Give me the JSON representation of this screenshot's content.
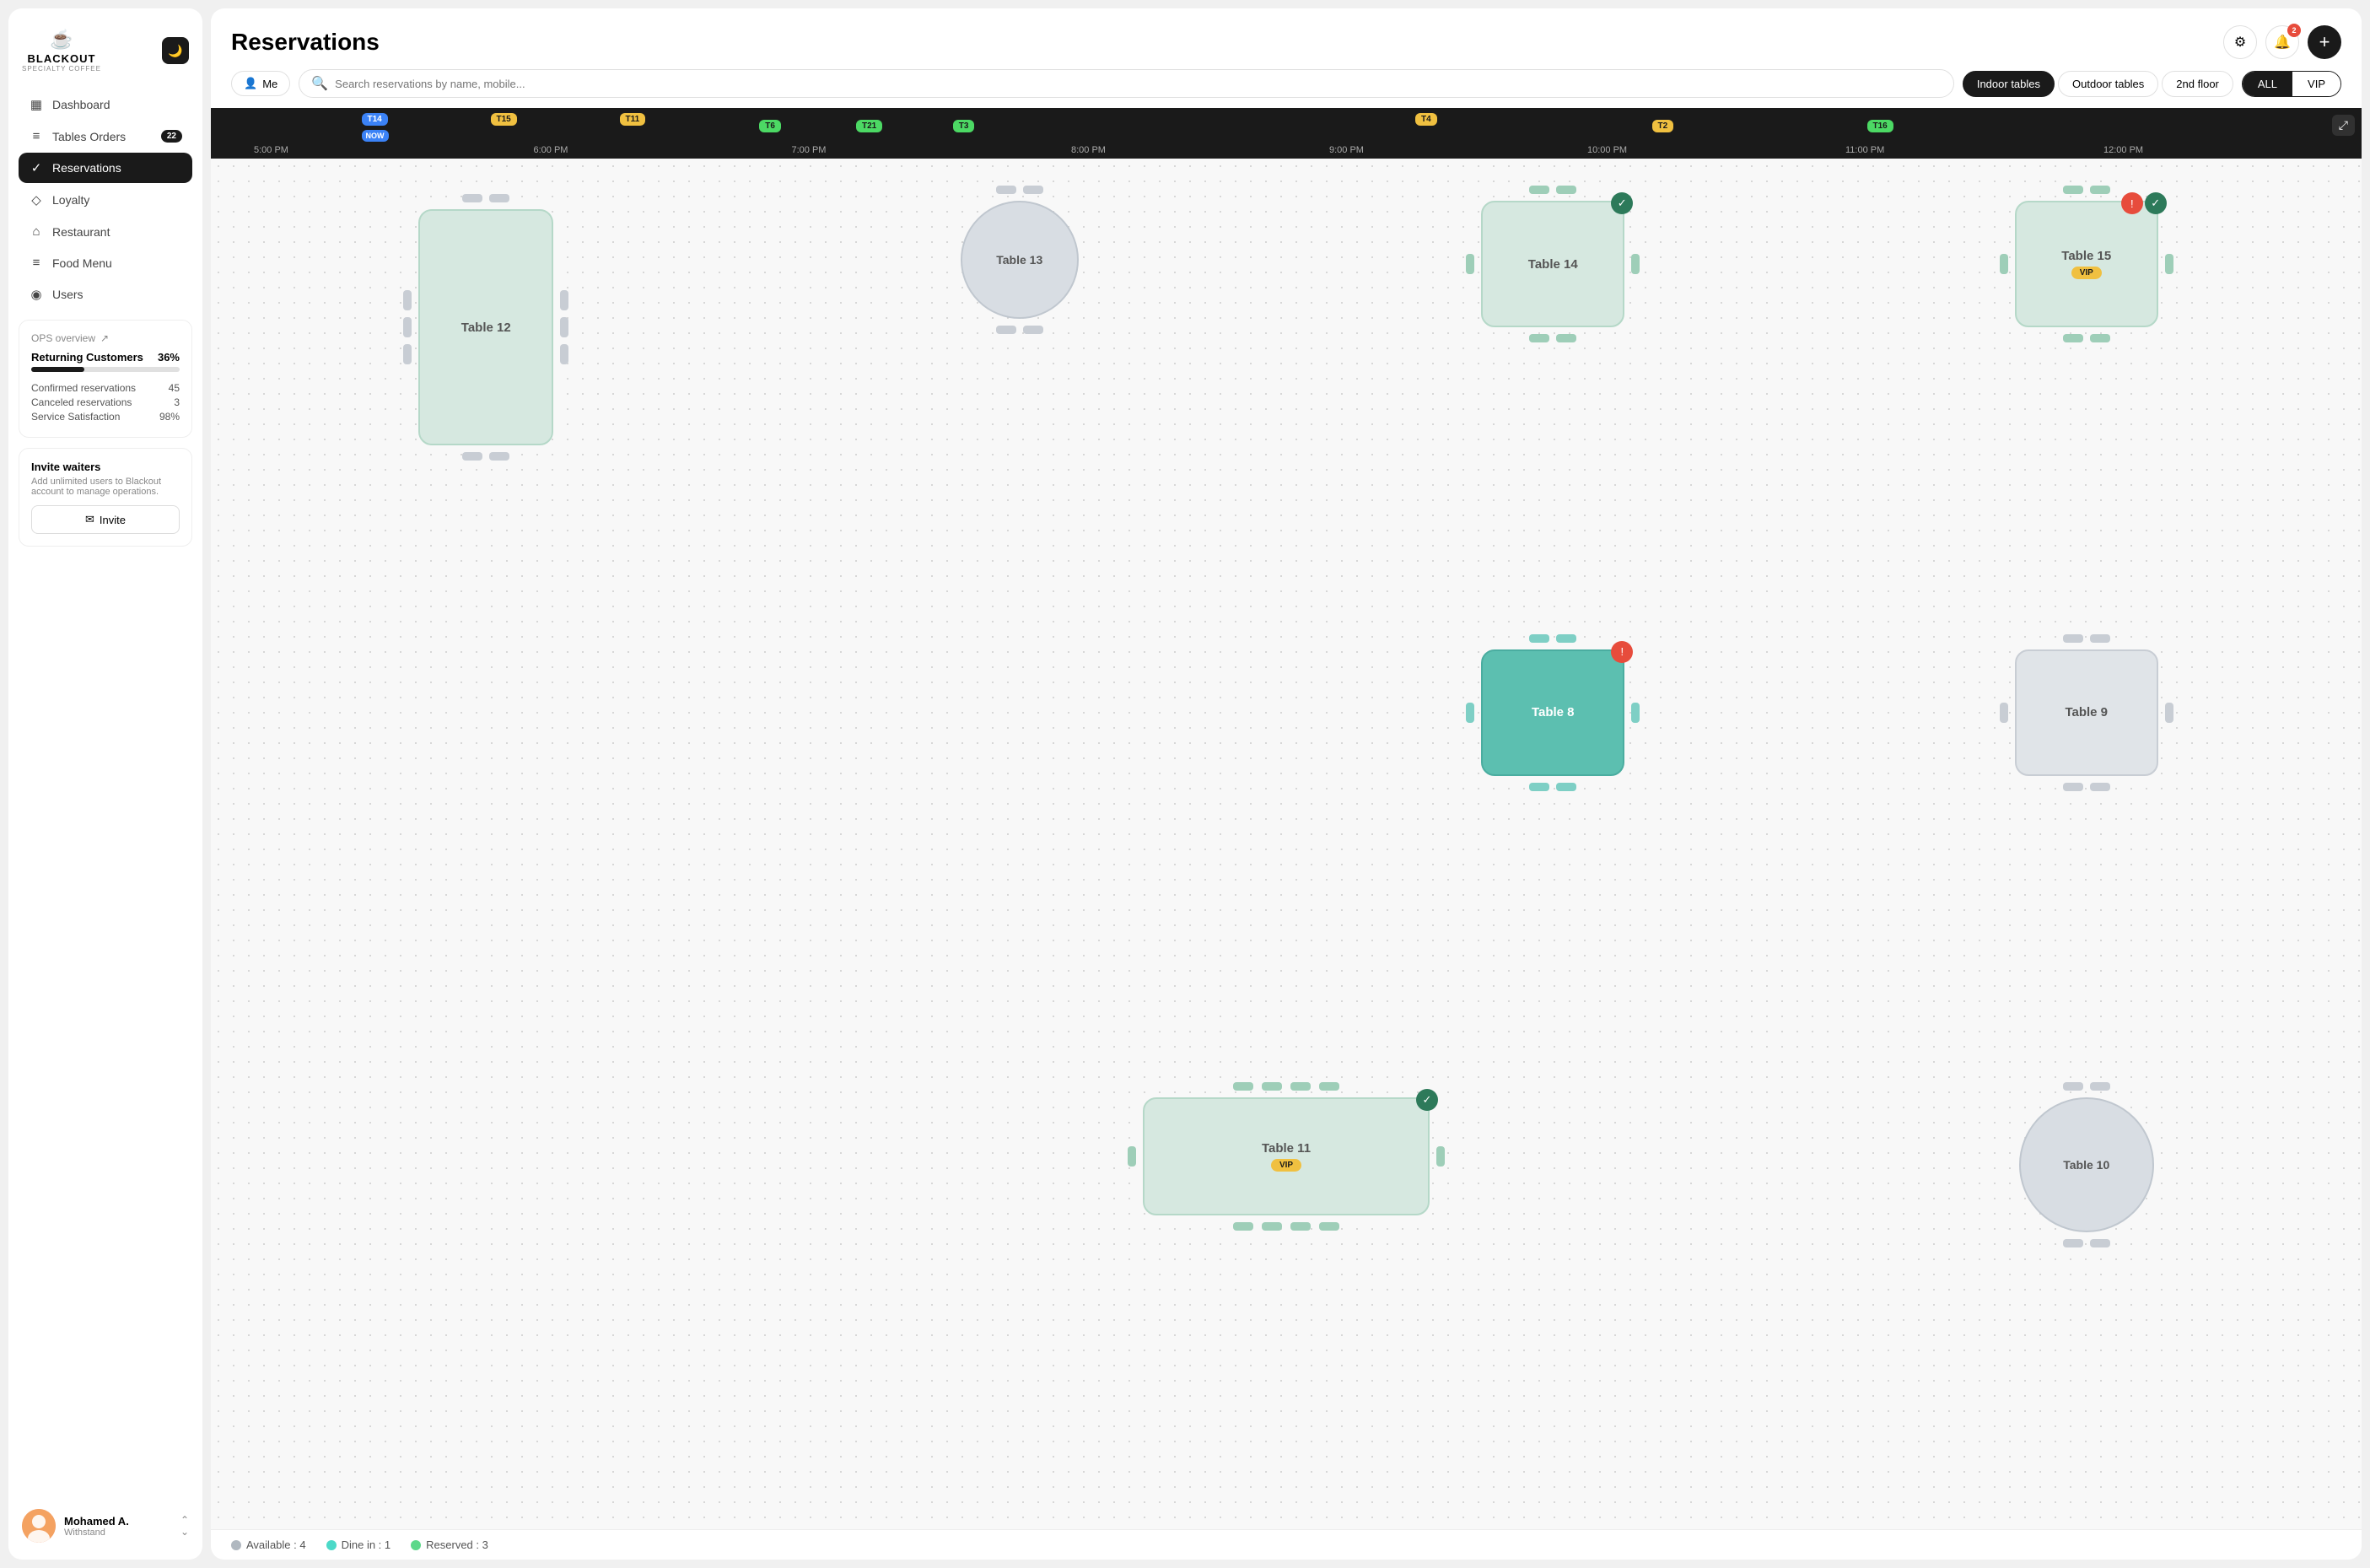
{
  "sidebar": {
    "logo": {
      "icon": "☕",
      "brand": "BLACKOUT",
      "sub": "SPECIALTY COFFEE"
    },
    "nav": [
      {
        "id": "dashboard",
        "icon": "▦",
        "label": "Dashboard",
        "badge": null,
        "active": false
      },
      {
        "id": "tables-orders",
        "icon": "≡",
        "label": "Tables Orders",
        "badge": "22",
        "active": false
      },
      {
        "id": "reservations",
        "icon": "✓",
        "label": "Reservations",
        "badge": null,
        "active": true
      },
      {
        "id": "loyalty",
        "icon": "◇",
        "label": "Loyalty",
        "badge": null,
        "active": false
      },
      {
        "id": "restaurant",
        "icon": "⌂",
        "label": "Restaurant",
        "badge": null,
        "active": false
      },
      {
        "id": "food-menu",
        "icon": "≡",
        "label": "Food Menu",
        "badge": null,
        "active": false
      },
      {
        "id": "users",
        "icon": "◉",
        "label": "Users",
        "badge": null,
        "active": false
      }
    ],
    "ops": {
      "title": "OPS overview",
      "returning_label": "Returning Customers",
      "returning_pct": "36%",
      "progress": 36,
      "stats": [
        {
          "label": "Confirmed reservations",
          "value": "45"
        },
        {
          "label": "Canceled reservations",
          "value": "3"
        },
        {
          "label": "Service Satisfaction",
          "value": "98%"
        }
      ]
    },
    "invite": {
      "title": "Invite waiters",
      "desc": "Add unlimited users to Blackout account to manage operations.",
      "btn_label": "Invite"
    },
    "user": {
      "name": "Mohamed A.",
      "role": "Withstand"
    }
  },
  "header": {
    "title": "Reservations",
    "notif_count": "2"
  },
  "toolbar": {
    "me_label": "Me",
    "search_placeholder": "Search reservations by name, mobile...",
    "tabs": [
      {
        "id": "indoor",
        "label": "Indoor tables",
        "active": true
      },
      {
        "id": "outdoor",
        "label": "Outdoor tables",
        "active": false
      },
      {
        "id": "2nd-floor",
        "label": "2nd floor",
        "active": false
      }
    ],
    "filters": [
      {
        "id": "all",
        "label": "ALL",
        "active": true
      },
      {
        "id": "vip",
        "label": "VIP",
        "active": false
      }
    ]
  },
  "timeline": {
    "times": [
      "5:00 PM",
      "6:00 PM",
      "7:00 PM",
      "8:00 PM",
      "9:00 PM",
      "10:00 PM",
      "11:00 PM",
      "12:00 PM"
    ],
    "chips": [
      {
        "id": "T14",
        "label": "T14",
        "style": "blue",
        "left_pct": 8
      },
      {
        "id": "NOW",
        "label": "NOW",
        "style": "now",
        "left_pct": 8
      },
      {
        "id": "T15",
        "label": "T15",
        "style": "yellow",
        "left_pct": 14
      },
      {
        "id": "T11",
        "label": "T11",
        "style": "yellow",
        "left_pct": 20
      },
      {
        "id": "T6",
        "label": "T6",
        "style": "green",
        "left_pct": 27
      },
      {
        "id": "T21",
        "label": "T21",
        "style": "green",
        "left_pct": 32
      },
      {
        "id": "T3",
        "label": "T3",
        "style": "green",
        "left_pct": 36
      },
      {
        "id": "T4",
        "label": "T4",
        "style": "yellow",
        "left_pct": 58
      },
      {
        "id": "T2",
        "label": "T2",
        "style": "yellow",
        "left_pct": 70
      },
      {
        "id": "T16",
        "label": "T16",
        "style": "green",
        "left_pct": 79
      }
    ]
  },
  "tables": [
    {
      "id": "t12",
      "label": "Table 12",
      "type": "large-rect",
      "status": "available",
      "vip": false,
      "check": false,
      "alert": false
    },
    {
      "id": "t13",
      "label": "Table 13",
      "type": "circle",
      "status": "gray",
      "vip": false,
      "check": false,
      "alert": false
    },
    {
      "id": "t14",
      "label": "Table 14",
      "type": "rect",
      "status": "available",
      "vip": false,
      "check": true,
      "alert": false
    },
    {
      "id": "t15",
      "label": "Table 15",
      "type": "rect",
      "status": "available",
      "vip": true,
      "check": true,
      "alert": true
    },
    {
      "id": "t8",
      "label": "Table 8",
      "type": "rect",
      "status": "occupied",
      "vip": false,
      "check": false,
      "alert": true
    },
    {
      "id": "t9",
      "label": "Table 9",
      "type": "rect",
      "status": "gray",
      "vip": false,
      "check": false,
      "alert": false
    },
    {
      "id": "t11",
      "label": "Table 11",
      "type": "wide-rect",
      "status": "available",
      "vip": true,
      "check": true,
      "alert": false
    },
    {
      "id": "t10",
      "label": "Table 10",
      "type": "circle",
      "status": "gray",
      "vip": false,
      "check": false,
      "alert": false
    }
  ],
  "legend": [
    {
      "id": "available",
      "label": "Available : 4",
      "dot": "gray"
    },
    {
      "id": "dine-in",
      "label": "Dine in : 1",
      "dot": "teal"
    },
    {
      "id": "reserved",
      "label": "Reserved : 3",
      "dot": "green"
    }
  ]
}
